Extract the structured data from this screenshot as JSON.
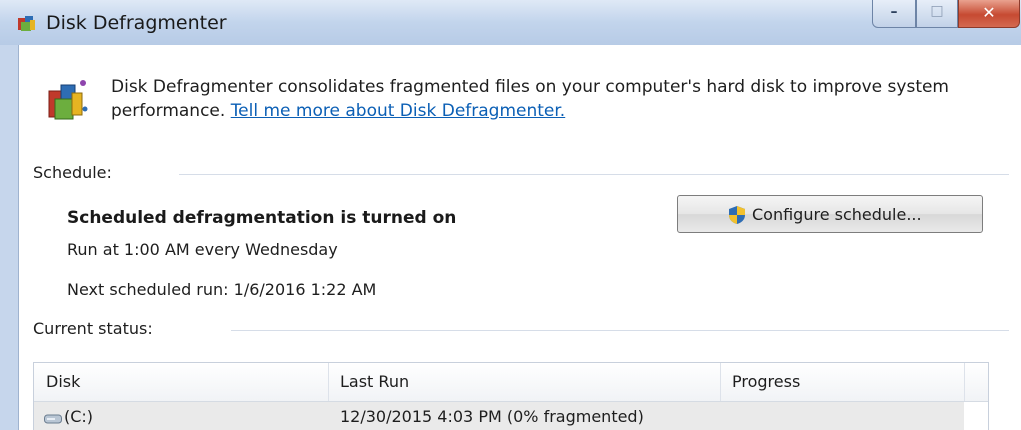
{
  "window": {
    "title": "Disk Defragmenter",
    "controls": {
      "minimize": "–",
      "maximize": "□",
      "close": "✕"
    }
  },
  "header": {
    "description": "Disk Defragmenter consolidates fragmented files on your computer's hard disk to improve system performance.",
    "link_text": "Tell me more about Disk Defragmenter.",
    "icon": "defragmenter-icon"
  },
  "schedule": {
    "label": "Schedule:",
    "status": "Scheduled defragmentation is turned on",
    "run_at": "Run at 1:00 AM every Wednesday",
    "next_run": "Next scheduled run: 1/6/2016 1:22 AM",
    "configure_button": "Configure schedule...",
    "configure_icon": "uac-shield-icon"
  },
  "current_status": {
    "label": "Current status:",
    "columns": [
      "Disk",
      "Last Run",
      "Progress"
    ],
    "rows": [
      {
        "disk": "(C:)",
        "last_run": "12/30/2015 4:03 PM (0% fragmented)",
        "progress": "",
        "icon": "hard-drive-icon"
      }
    ]
  },
  "colors": {
    "link": "#0b5fb5",
    "close_button": "#c64a32",
    "titlebar": "#c2d4ec"
  }
}
